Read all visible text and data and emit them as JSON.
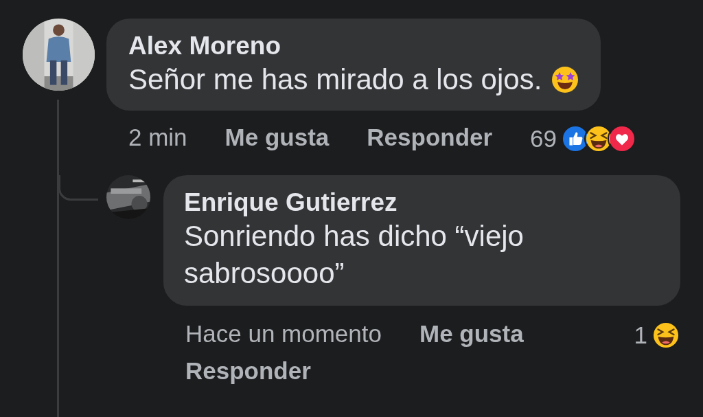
{
  "comments": [
    {
      "author": "Alex Moreno",
      "text": "Señor me has mirado a los ojos.",
      "text_emoji": {
        "kind": "star-struck"
      },
      "time": "2 min",
      "actions": [
        "Me gusta",
        "Responder"
      ],
      "reaction_count": "69",
      "reactions": [
        {
          "kind": "like"
        },
        {
          "kind": "haha"
        },
        {
          "kind": "love"
        }
      ],
      "children": [
        {
          "author": "Enrique Gutierrez",
          "text": "Sonriendo has dicho “viejo sabrosoooo”",
          "time": "Hace un momento",
          "actions": [
            "Me gusta",
            "Responder"
          ],
          "reaction_count": "1",
          "reactions": [
            {
              "kind": "haha"
            }
          ]
        }
      ]
    }
  ]
}
